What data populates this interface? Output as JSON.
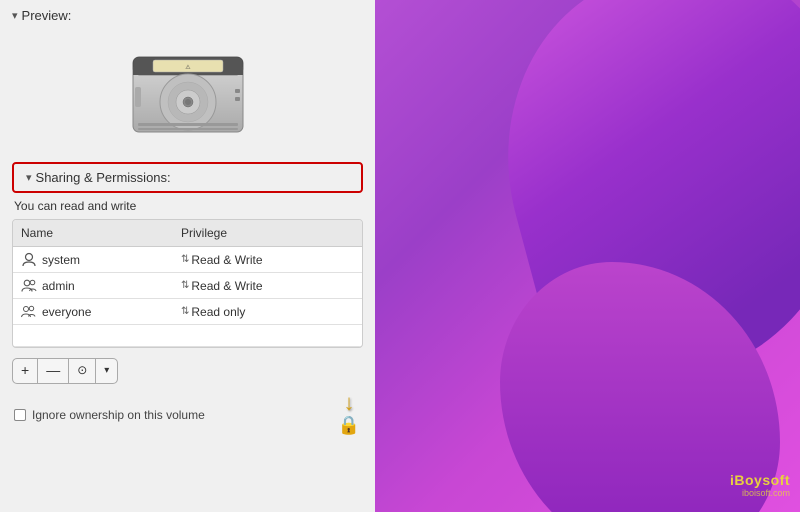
{
  "left_panel": {
    "preview_label": "Preview:",
    "sharing_header_label": "Sharing & Permissions:",
    "read_write_text": "You can read and write",
    "table": {
      "col_name": "Name",
      "col_privilege": "Privilege",
      "rows": [
        {
          "name": "system",
          "icon": "single-user",
          "privilege": "Read & Write"
        },
        {
          "name": "admin",
          "icon": "multi-user",
          "privilege": "Read & Write"
        },
        {
          "name": "everyone",
          "icon": "multi-user",
          "privilege": "Read only"
        }
      ]
    },
    "btn_add": "+",
    "btn_remove": "—",
    "btn_action": "⊙",
    "btn_dropdown": "▾",
    "ignore_ownership_label": "Ignore ownership on this volume",
    "lock_icon": "🔒"
  },
  "watermark": {
    "brand": "iBoysoft",
    "domain": "iboisoft.com"
  },
  "colors": {
    "red_border": "#cc0000",
    "lock_arrow": "#d4a017",
    "bg_left": "#f0f0f0",
    "bg_right_start": "#b44fd4",
    "bg_right_end": "#e050e0"
  }
}
